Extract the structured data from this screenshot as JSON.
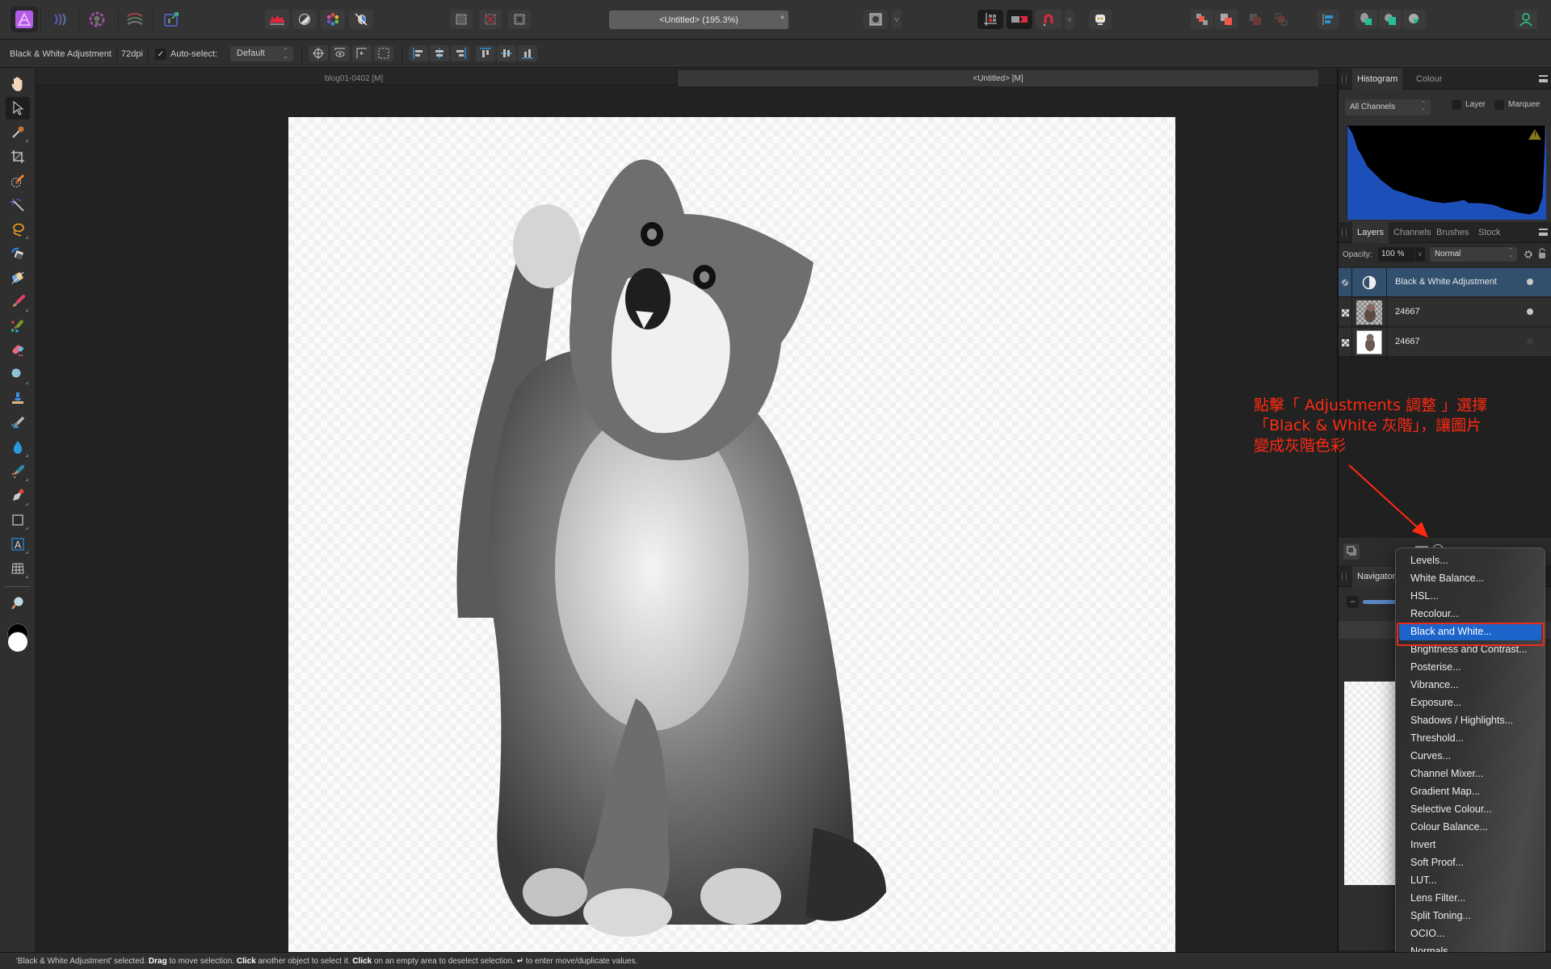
{
  "topbar": {
    "personas": [
      {
        "name": "photo-persona",
        "active": true
      },
      {
        "name": "liquify-persona"
      },
      {
        "name": "develop-persona"
      },
      {
        "name": "tone-mapping-persona"
      },
      {
        "name": "export-persona"
      }
    ],
    "document_title": "<Untitled> (195.3%)",
    "modified_marker": "*",
    "dropdown_arrow": "v"
  },
  "context_toolbar": {
    "selection_label": "Black & White Adjustment",
    "dpi": "72dpi",
    "auto_select_checked": true,
    "auto_select_check_glyph": "✓",
    "auto_select_label": "Auto-select:",
    "auto_select_value": "Default",
    "updown_glyph": "⌃⌄"
  },
  "doc_tabs": [
    {
      "label": "blog01-0402 [M]",
      "active": false
    },
    {
      "label": "<Untitled> [M]",
      "active": true
    }
  ],
  "tools": [
    "hand-tool",
    "move-tool",
    "color-picker-tool",
    "crop-tool",
    "selection-brush-tool",
    "flood-select-tool",
    "freehand-selection-tool",
    "flood-fill-tool",
    "gradient-tool",
    "paint-brush-tool",
    "pixel-tool",
    "erase-brush-tool",
    "dodge-brush-tool",
    "clone-brush-tool",
    "smudge-brush-tool",
    "blur-brush-tool",
    "sponge-brush-tool",
    "pen-tool",
    "rectangle-tool",
    "artistic-text-tool",
    "mesh-warp-tool",
    "zoom-tool"
  ],
  "histogram_panel": {
    "tabs": [
      "Histogram",
      "Colour"
    ],
    "active_tab": "Histogram",
    "channel_select": "All Channels",
    "layer_checkbox_label": "Layer",
    "marquee_checkbox_label": "Marquee",
    "warning_glyph": "!",
    "graph_color": "#1d4fb8"
  },
  "layers_panel": {
    "tabs": [
      "Layers",
      "Channels",
      "Brushes",
      "Stock"
    ],
    "active_tab": "Layers",
    "opacity_label": "Opacity:",
    "opacity_value": "100 %",
    "blend_mode": "Normal",
    "layers": [
      {
        "name": "Black & White Adjustment",
        "type": "adjustment",
        "selected": true,
        "visible": true
      },
      {
        "name": "24667",
        "type": "pixel",
        "selected": false,
        "visible": true
      },
      {
        "name": "24667",
        "type": "pixel",
        "selected": false,
        "visible": false
      }
    ]
  },
  "navigator_panel": {
    "title": "Navigator"
  },
  "annotation": {
    "lines": [
      "點擊「 Adjustments 調整 」選擇",
      "「Black & White 灰階」，讓圖片",
      "變成灰階色彩"
    ],
    "color": "#ff2a12"
  },
  "adjustments_menu": {
    "items": [
      "Levels...",
      "White Balance...",
      "HSL...",
      "Recolour...",
      "Black and White...",
      "Brightness and Contrast...",
      "Posterise...",
      "Vibrance...",
      "Exposure...",
      "Shadows / Highlights...",
      "Threshold...",
      "Curves...",
      "Channel Mixer...",
      "Gradient Map...",
      "Selective Colour...",
      "Colour Balance...",
      "Invert",
      "Soft Proof...",
      "LUT...",
      "Lens Filter...",
      "Split Toning...",
      "OCIO...",
      "Normals..."
    ],
    "highlighted_index": 4,
    "highlight_color": "#1c64c9"
  },
  "status_bar": {
    "segments": [
      {
        "text": "'Black & White Adjustment' selected. ",
        "bold": false
      },
      {
        "text": "Drag",
        "bold": true
      },
      {
        "text": " to move selection. ",
        "bold": false
      },
      {
        "text": "Click",
        "bold": true
      },
      {
        "text": " another object to select it. ",
        "bold": false
      },
      {
        "text": "Click",
        "bold": true
      },
      {
        "text": " on an empty area to deselect selection. ",
        "bold": false
      },
      {
        "text": "↵",
        "bold": true
      },
      {
        "text": " to enter move/duplicate values.",
        "bold": false
      }
    ]
  }
}
